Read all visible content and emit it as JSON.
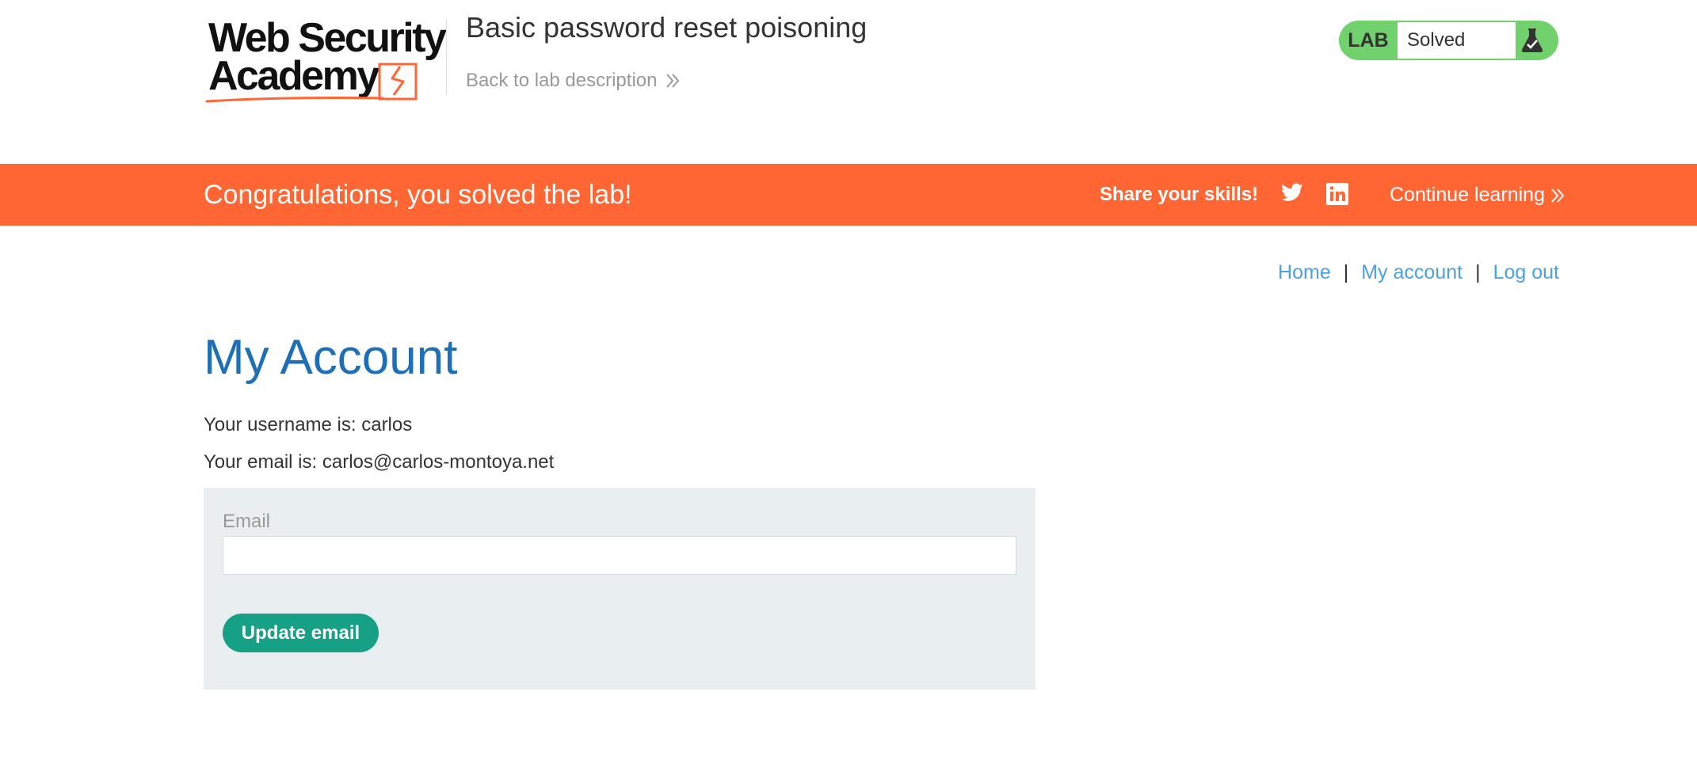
{
  "header": {
    "logo_line1": "Web Security",
    "logo_line2": "Academy",
    "lab_title": "Basic password reset poisoning",
    "back_link": "Back to lab description",
    "badge_label": "LAB",
    "badge_status": "Solved"
  },
  "banner": {
    "message": "Congratulations, you solved the lab!",
    "share": "Share your skills!",
    "continue": "Continue learning"
  },
  "nav": {
    "home": "Home",
    "sep": "|",
    "my_account": "My account",
    "log_out": "Log out"
  },
  "main": {
    "title": "My Account",
    "username_text": "Your username is: carlos",
    "email_text": "Your email is: carlos@carlos-montoya.net",
    "form": {
      "email_label": "Email",
      "email_value": "",
      "button": "Update email"
    }
  },
  "colors": {
    "accent_orange": "#ff6633",
    "badge_green": "#70d16d",
    "link_blue": "#4aa2df",
    "title_blue": "#1d70b8",
    "button_teal": "#16a085",
    "form_bg": "#e9eef0"
  },
  "icons": [
    "logo-bolt-icon",
    "double-chevron-right-icon",
    "flask-icon",
    "twitter-icon",
    "linkedin-icon"
  ]
}
